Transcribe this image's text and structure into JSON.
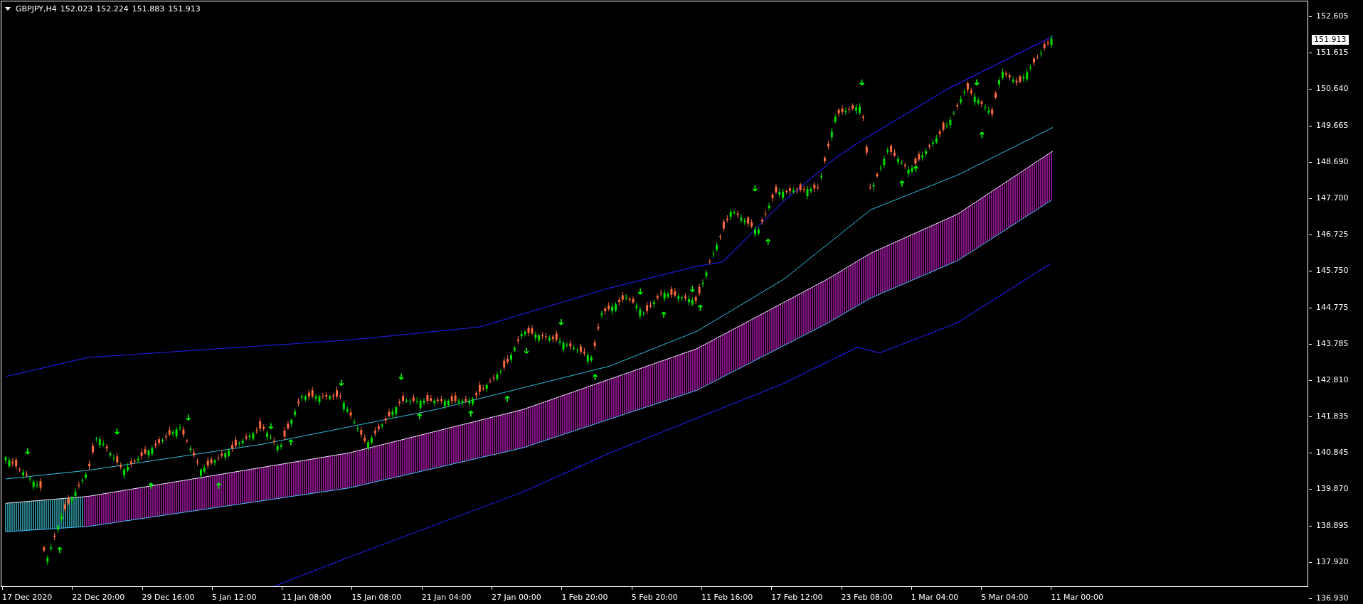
{
  "header": {
    "symbol": "GBPJPY,H4",
    "prices": [
      "152.023",
      "152.224",
      "151.883",
      "151.913"
    ]
  },
  "price_axis": [
    "152.605",
    "151.615",
    "150.640",
    "149.665",
    "148.690",
    "147.700",
    "146.725",
    "145.750",
    "144.775",
    "143.785",
    "142.810",
    "141.835",
    "140.845",
    "139.870",
    "138.895",
    "137.920",
    "136.930"
  ],
  "current_price": "151.913",
  "time_axis": [
    "17 Dec 2020",
    "22 Dec 20:00",
    "29 Dec 16:00",
    "5 Jan 12:00",
    "11 Jan 08:00",
    "15 Jan 08:00",
    "21 Jan 04:00",
    "27 Jan 00:00",
    "1 Feb 20:00",
    "5 Feb 20:00",
    "11 Feb 16:00",
    "17 Feb 12:00",
    "23 Feb 08:00",
    "1 Mar 04:00",
    "5 Mar 04:00",
    "11 Mar 00:00"
  ]
}
